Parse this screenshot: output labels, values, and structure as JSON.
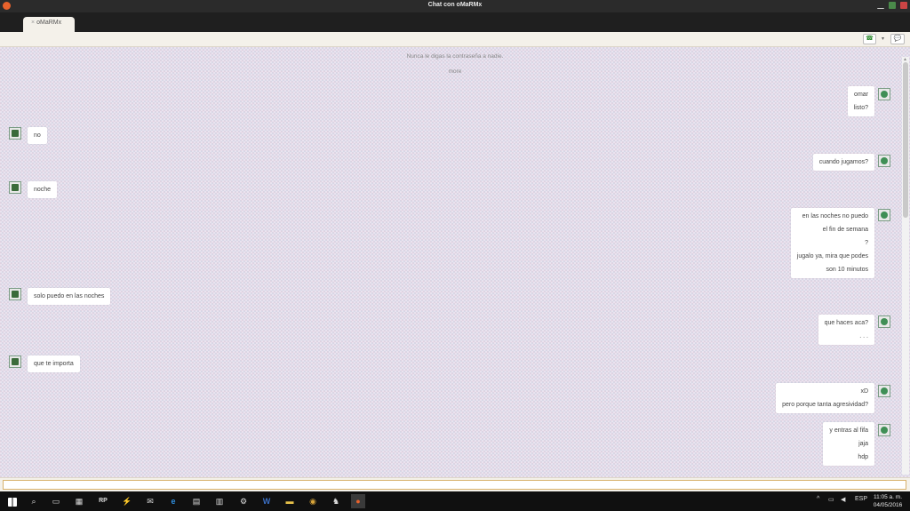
{
  "window": {
    "title": "Chat con oMaRMx"
  },
  "tab": {
    "label": "oMaRMx"
  },
  "chat": {
    "notices": [
      "Nunca le digas la contraseña a nadie.",
      "more"
    ],
    "messages": [
      {
        "side": "right",
        "lines": [
          "omar",
          "listo?"
        ]
      },
      {
        "side": "left",
        "lines": [
          "no"
        ]
      },
      {
        "side": "right",
        "lines": [
          "cuando jugamos?"
        ]
      },
      {
        "side": "left",
        "lines": [
          "noche"
        ]
      },
      {
        "side": "right",
        "lines": [
          "en las noches no puedo",
          "el fin de semana",
          "?",
          "jugalo ya, mira que podes",
          "son 10 minutos"
        ]
      },
      {
        "side": "left",
        "lines": [
          "solo puedo en las noches"
        ]
      },
      {
        "side": "right",
        "lines": [
          "que haces aca?",
          ". . ."
        ]
      },
      {
        "side": "left",
        "lines": [
          "que te importa"
        ]
      },
      {
        "side": "right",
        "lines": [
          "xD",
          "pero porque tanta agresividad?"
        ]
      },
      {
        "side": "right",
        "lines": [
          "y entras al fifa",
          "jaja",
          "hdp"
        ]
      }
    ]
  },
  "input": {
    "value": "",
    "placeholder": ""
  },
  "taskbar": {
    "apps": [
      {
        "icon": "search-icon",
        "glyph": "⌕"
      },
      {
        "icon": "task-view-icon",
        "glyph": "▭"
      },
      {
        "icon": "store-icon",
        "glyph": "▦"
      },
      {
        "icon": "rp-icon",
        "glyph": "RP"
      },
      {
        "icon": "flash-icon",
        "glyph": "⚡"
      },
      {
        "icon": "mail-icon",
        "glyph": "✉"
      },
      {
        "icon": "edge-icon",
        "glyph": "e"
      },
      {
        "icon": "calculator-icon",
        "glyph": "▤"
      },
      {
        "icon": "disk-icon",
        "glyph": "▥"
      },
      {
        "icon": "network-icon",
        "glyph": "⚙"
      },
      {
        "icon": "word-icon",
        "glyph": "W"
      },
      {
        "icon": "folder-icon",
        "glyph": "▬"
      },
      {
        "icon": "chrome-icon",
        "glyph": "◉"
      },
      {
        "icon": "mouse-icon",
        "glyph": "♞"
      },
      {
        "icon": "chat-app-icon",
        "glyph": "●"
      }
    ],
    "language": "ESP",
    "time": "11:05 a. m.",
    "date": "04/05/2016"
  },
  "colors": {
    "titlebar": "#2b2b2b",
    "accent": "#e8622c",
    "input_border": "#d8b26d",
    "taskbar": "#101010"
  }
}
